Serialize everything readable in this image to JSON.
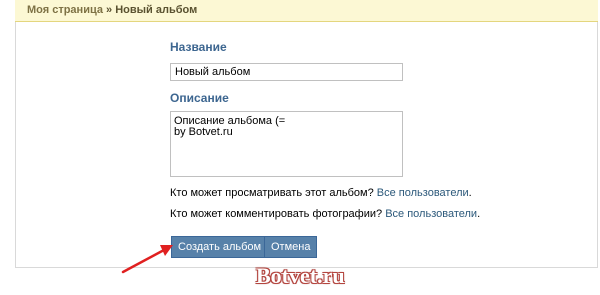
{
  "breadcrumb": {
    "parent": "Моя страница",
    "separator": " » ",
    "current": "Новый альбом"
  },
  "form": {
    "title_label": "Название",
    "title_value": "Новый альбом",
    "description_label": "Описание",
    "description_value": "Описание альбома (=\nby Botvet.ru",
    "view_question": "Кто может просматривать этот альбом?",
    "view_value": "Все пользователи",
    "comment_question": "Кто может комментировать фотографии?",
    "comment_value": "Все пользователи",
    "period": "."
  },
  "buttons": {
    "create_label": "Создать альбом",
    "cancel_label": "Отмена"
  },
  "annotation": {
    "arrow_color": "#e02020"
  },
  "watermark": {
    "text": "Botvet.ru"
  },
  "colors": {
    "header_bg": "#fcf8d4",
    "label_blue": "#3d6690",
    "link_blue": "#2b587a",
    "button_bg": "#5781a9"
  }
}
